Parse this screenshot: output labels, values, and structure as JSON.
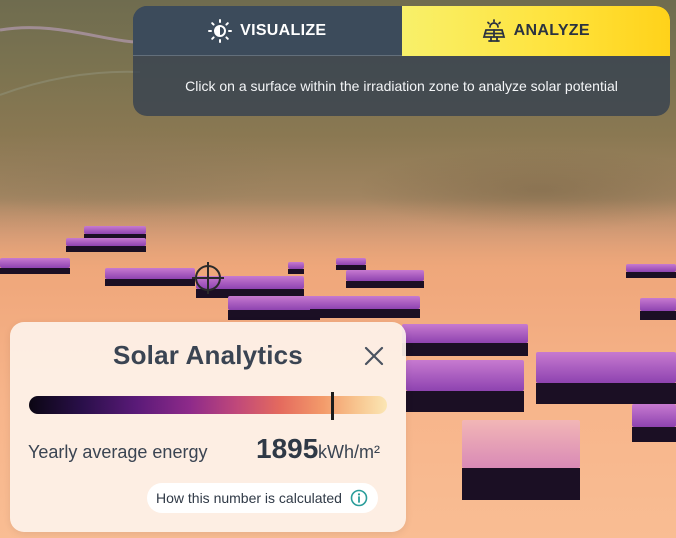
{
  "mode_tabs": {
    "visualize": {
      "label": "VISUALIZE",
      "icon": "sun-brightness-icon"
    },
    "analyze": {
      "label": "ANALYZE",
      "icon": "solar-panel-icon"
    }
  },
  "instruction": "Click on a surface within the irradiation zone to analyze solar potential",
  "card": {
    "title": "Solar Analytics",
    "metric_label": "Yearly average energy",
    "metric_value": "1895",
    "metric_unit": "kWh/m²",
    "info_label": "How this number is calculated"
  },
  "colors": {
    "analyze_active": "#ffe23a",
    "panel_bg": "#374250",
    "roof_high": "#c77ad0",
    "ground": "#f7b58b"
  }
}
